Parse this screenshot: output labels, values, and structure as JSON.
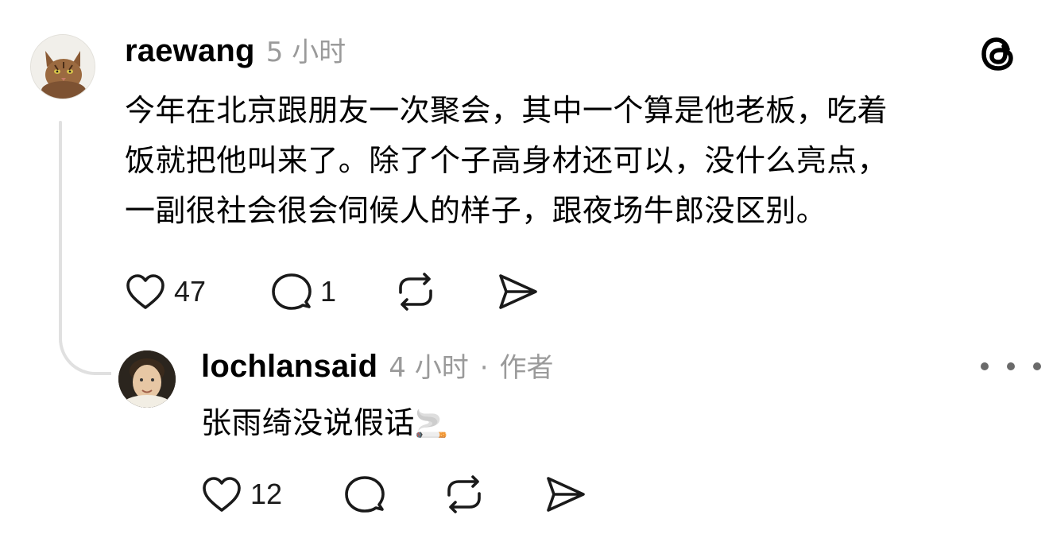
{
  "post": {
    "username": "raewang",
    "time": "5 小时",
    "lines": [
      "今年在北京跟朋友一次聚会，其中一个算是他老板，吃着",
      "饭就把他叫来了。除了个子高身材还可以，没什么亮点，",
      "一副很社会很会伺候人的样子，跟夜场牛郎没区别。"
    ],
    "likes": "47",
    "replies": "1",
    "avatar_icon": "cat-avatar"
  },
  "reply": {
    "username": "lochlansaid",
    "time": "4 小时",
    "separator": "·",
    "author_badge": "作者",
    "text": "张雨绮没说假话",
    "emoji": "🚬",
    "likes": "12",
    "avatar_icon": "person-avatar"
  },
  "app": {
    "logo_icon": "threads-logo-icon",
    "more_icon": "more-options-icon"
  }
}
